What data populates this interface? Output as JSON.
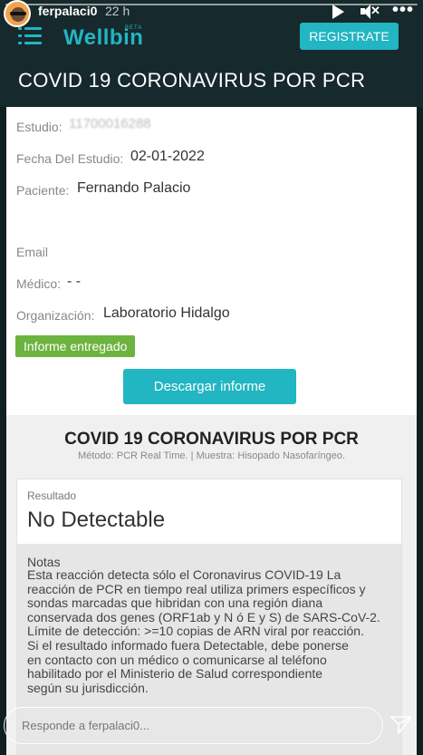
{
  "story": {
    "username": "ferpalaci0",
    "time_ago": "22 h",
    "reply_placeholder": "Responde a ferpalaci0...",
    "icons": [
      "play-icon",
      "mute-icon",
      "more-icon",
      "send-icon"
    ]
  },
  "app": {
    "logo": "Wellbin",
    "logo_tag": "BETA",
    "register_label": "REGISTRATE",
    "accent_color": "#22b5c2",
    "header_color": "#16292d"
  },
  "study": {
    "title": "COVID 19 CORONAVIRUS POR PCR",
    "fields": [
      {
        "label": "Estudio:",
        "value": "11700016288"
      },
      {
        "label": "Fecha Del Estudio:",
        "value": "02-01-2022"
      },
      {
        "label": "Paciente:",
        "value": "Fernando Palacio"
      },
      {
        "label": "Email",
        "value": ""
      },
      {
        "label": "Médico:",
        "value": "- -"
      },
      {
        "label": "Organización:",
        "value": "Laboratorio Hidalgo"
      }
    ],
    "status_badge": "Informe entregado",
    "status_color": "#6cb33f",
    "download_label": "Descargar informe"
  },
  "report": {
    "title": "COVID 19 CORONAVIRUS POR PCR",
    "method": "Método: PCR Real Time. | Muestra: Hisopado Nasofaríngeo.",
    "result_label": "Resultado",
    "result_value": "No Detectable",
    "notes_title": "Notas",
    "notes_lines": [
      "Esta reacción detecta sólo el Coronavirus COVID-19 La",
      "reacción de PCR en tiempo real utiliza primers específicos y",
      "sondas marcadas que hibridan con una región diana",
      "conservada dos genes (ORF1ab y N ó E y S) de SARS-CoV-2.",
      "Límite de detección: >=10 copias de ARN viral por reacción.",
      "Si el resultado informado fuera Detectable, debe ponerse",
      "en contacto con un médico o comunicarse al teléfono",
      "habilitado por el Ministerio de Salud correspondiente",
      "según su jurisdicción."
    ]
  }
}
